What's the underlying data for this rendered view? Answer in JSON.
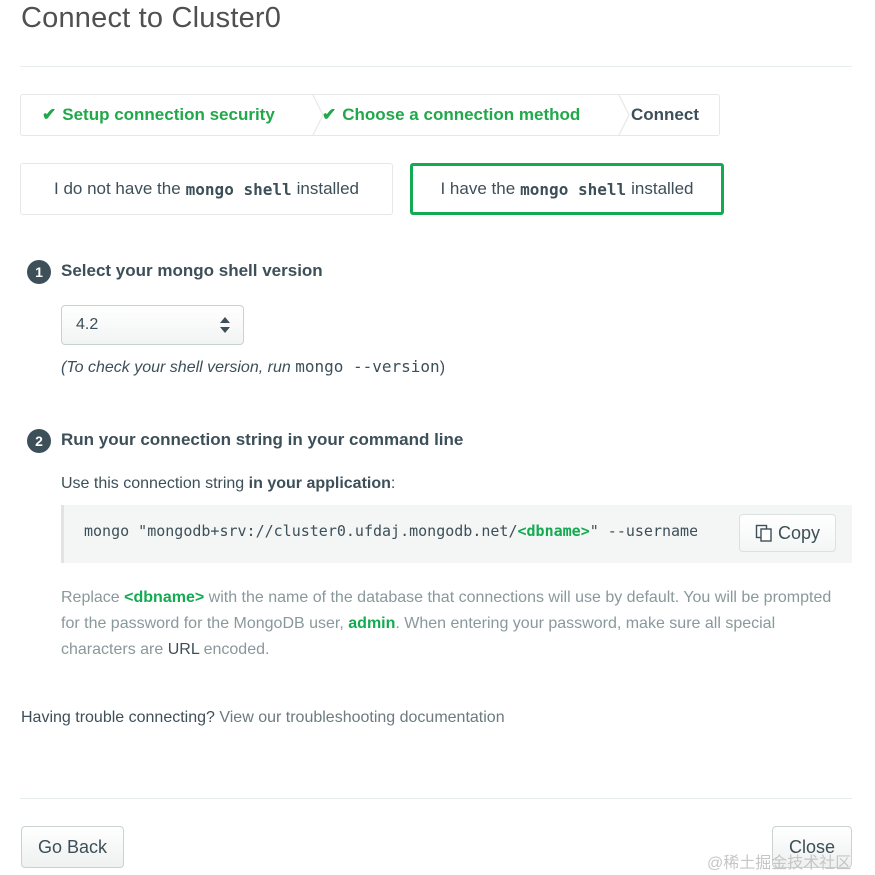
{
  "modal": {
    "title": "Connect to Cluster0"
  },
  "steps": [
    {
      "label": "Setup connection security",
      "status": "done"
    },
    {
      "label": "Choose a connection method",
      "status": "done"
    },
    {
      "label": "Connect",
      "status": "current"
    }
  ],
  "shell_options": {
    "not_installed": {
      "prefix": "I do not have the",
      "code": "mongo shell",
      "suffix": "installed"
    },
    "installed": {
      "prefix": "I have the",
      "code": "mongo shell",
      "suffix": "installed",
      "selected": true
    }
  },
  "step1": {
    "number": "1",
    "heading": "Select your mongo shell version",
    "selected_version": "4.2",
    "hint_prefix": "(To check your shell version, run",
    "hint_code": "mongo --version",
    "hint_suffix": ")"
  },
  "step2": {
    "number": "2",
    "heading": "Run your connection string in your command line",
    "use_prefix": "Use this connection string",
    "use_bold": "in your application",
    "use_suffix": ":",
    "conn_before": "mongo \"mongodb+srv://cluster0.ufdaj.mongodb.net/",
    "conn_dbname": "<dbname>",
    "conn_after": "\" --username",
    "copy_label": "Copy"
  },
  "replace_note": {
    "t1": "Replace",
    "dbname": "<dbname>",
    "t2": "with the name of the database that connections will use by default. You will be prompted for the password for the MongoDB user,",
    "user": "admin",
    "t3": ". When entering your password, make sure all special characters are",
    "url": "URL",
    "t4": "encoded."
  },
  "trouble": {
    "text": "Having trouble connecting?",
    "link": "View our troubleshooting documentation"
  },
  "footer": {
    "back_label": "Go Back",
    "close_label": "Close"
  },
  "watermark": "@稀土掘金技术社区",
  "colors": {
    "accent_green": "#13aa52",
    "text_dark": "#3d4f58",
    "text_muted": "#89989b"
  }
}
